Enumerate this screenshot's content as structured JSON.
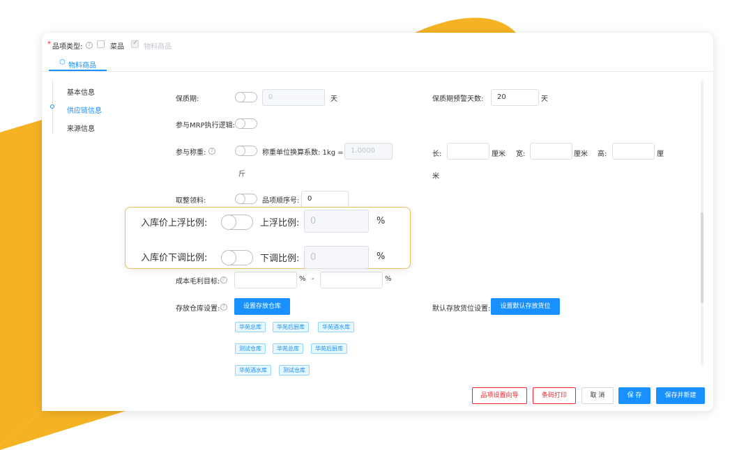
{
  "header": {
    "required_mark": "*",
    "item_type_label": "品项类型:",
    "option_dish": "菜品",
    "option_material": "物料商品"
  },
  "tab": {
    "label": "物料商品"
  },
  "sidebar": {
    "items": [
      {
        "label": "基本信息",
        "active": false
      },
      {
        "label": "供应链信息",
        "active": true
      },
      {
        "label": "来源信息",
        "active": false
      }
    ]
  },
  "form": {
    "shelf_life": {
      "label": "保质期:",
      "value": "0",
      "unit": "天"
    },
    "shelf_warn": {
      "label": "保质期预警天数:",
      "value": "20",
      "unit": "天"
    },
    "mrp": {
      "label": "参与MRP执行逻辑:"
    },
    "weigh": {
      "label": "参与称重:",
      "conv_label": "称重单位换算系数: 1kg =",
      "conv_value": "1.0000",
      "conv_unit": "斤"
    },
    "dims": {
      "length_label": "长:",
      "width_label": "宽:",
      "height_label": "高:",
      "unit_cm": "厘米",
      "unit_li": "厘",
      "unit_mi": "米"
    },
    "whole": {
      "label": "取整领料:",
      "order_label": "品项顺序号:",
      "order_value": "0"
    },
    "margin": {
      "label": "成本毛利目标:",
      "pct1": "%",
      "dash": "-",
      "pct2": "%"
    },
    "storage": {
      "label": "存放仓库设置:",
      "button": "设置存放仓库"
    },
    "default_loc": {
      "label": "默认存放货位设置:",
      "button": "设置默认存放货位"
    },
    "warehouse_tags": [
      [
        "华苑总库",
        "华苑后厨库",
        "华苑酒水库"
      ],
      [
        "测试仓库",
        "华苑总库",
        "华苑后厨库"
      ],
      [
        "华苑酒水库",
        "测试仓库"
      ]
    ]
  },
  "highlight": {
    "up_label": "入库价上浮比例:",
    "up_sub_label": "上浮比例:",
    "up_value": "0",
    "up_unit": "%",
    "down_label": "入库价下调比例:",
    "down_sub_label": "下调比例:",
    "down_value": "0",
    "down_unit": "%"
  },
  "footer": {
    "wizard": "品项设置向导",
    "barcode": "条码打印",
    "cancel": "取 消",
    "save": "保 存",
    "save_new": "保存并新建"
  },
  "colors": {
    "accent": "#1890ff",
    "danger": "#f5222d",
    "decor": "#f5b324",
    "highlight_border": "#e8c15a"
  }
}
